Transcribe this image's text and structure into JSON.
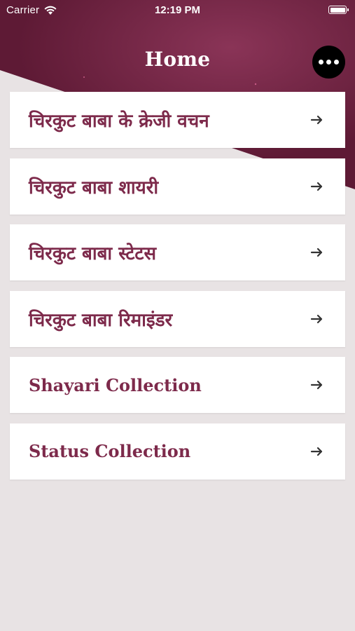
{
  "status_bar": {
    "carrier": "Carrier",
    "time": "12:19 PM",
    "wifi_icon": "wifi-icon",
    "battery_icon": "battery-icon"
  },
  "header": {
    "title": "Home",
    "menu_icon": "more-horizontal-icon"
  },
  "colors": {
    "header_bg": "#6e2240",
    "text_accent": "#7d2a4b",
    "page_bg": "#e8e3e4",
    "card_bg": "#ffffff"
  },
  "menu_items": [
    {
      "label": "चिरकुट बाबा के क्रेजी वचन",
      "icon": "arrow-right-icon"
    },
    {
      "label": "चिरकुट बाबा शायरी",
      "icon": "arrow-right-icon"
    },
    {
      "label": "चिरकुट बाबा स्टेटस",
      "icon": "arrow-right-icon"
    },
    {
      "label": "चिरकुट बाबा रिमाइंडर",
      "icon": "arrow-right-icon"
    },
    {
      "label": "Shayari Collection",
      "icon": "arrow-right-icon"
    },
    {
      "label": "Status Collection",
      "icon": "arrow-right-icon"
    }
  ]
}
